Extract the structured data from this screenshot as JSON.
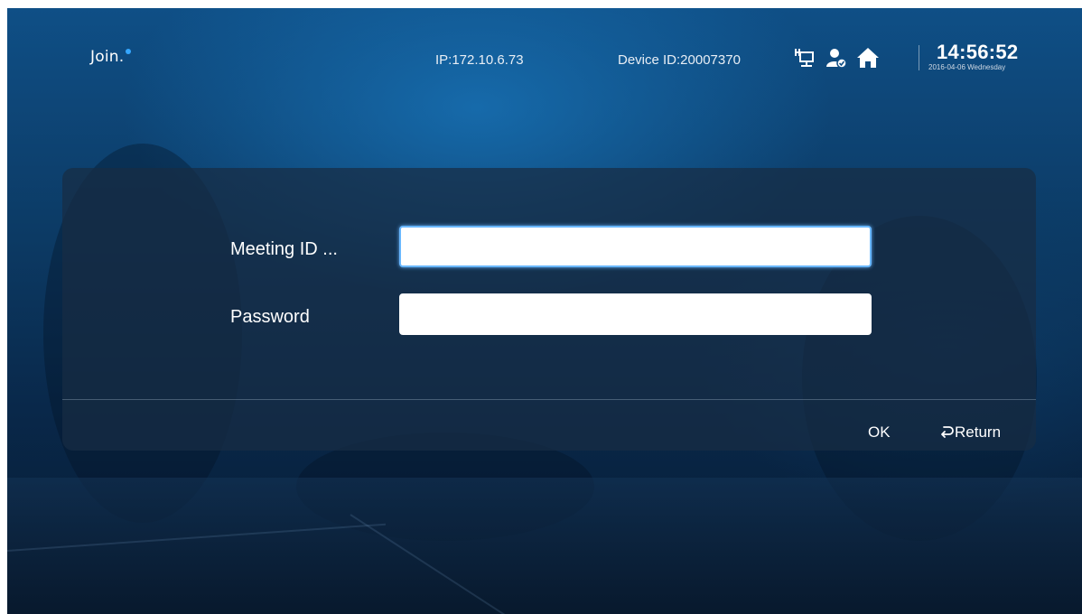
{
  "header": {
    "logo_text": "Join.",
    "logo_accent_color": "#35a7ff",
    "ip": "IP:172.10.6.73",
    "device_id": "Device ID:20007370",
    "status_icons": [
      "network-icon",
      "user-status-icon",
      "home-icon"
    ],
    "clock": {
      "time": "14:56:52",
      "date": "2016-04-06 Wednesday"
    }
  },
  "form": {
    "meeting_id_label": "Meeting ID ...",
    "meeting_id_value": "",
    "password_label": "Password",
    "password_value": ""
  },
  "actions": {
    "ok_label": "OK",
    "return_label": "Return"
  }
}
